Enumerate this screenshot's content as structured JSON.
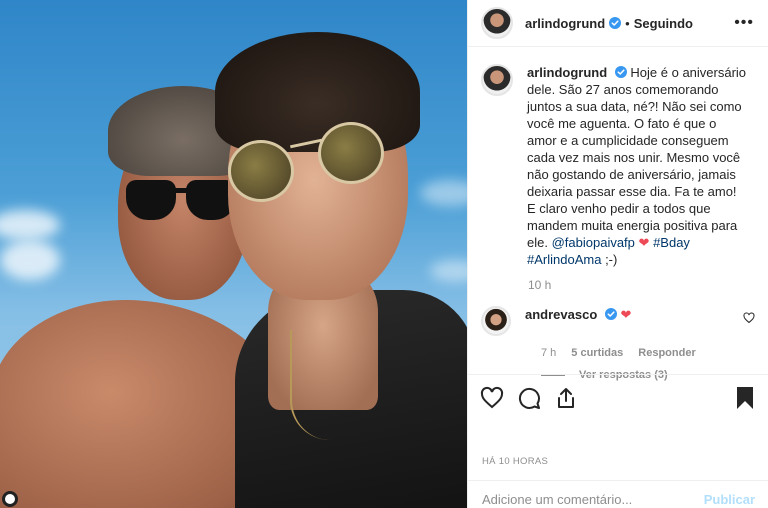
{
  "header": {
    "username": "arlindogrund",
    "separator": "•",
    "follow_status": "Seguindo",
    "more": "•••"
  },
  "caption": {
    "username": "arlindogrund",
    "text_before_mention": "Hoje é o aniversário dele. São 27 anos comemorando juntos a sua data, né?! Não sei como você me aguenta. O fato é que o amor e a cumplicidade conseguem cada vez mais nos unir. Mesmo você não gostando de aniversário, jamais deixaria passar esse dia. Fa te amo! E claro venho pedir a todos que mandem muita energia positiva para ele.",
    "mention": "@fabiopaivafp",
    "heart": "❤",
    "hashtag1": "#Bday",
    "hashtag2": "#ArlindoAma",
    "emoticon": ";-)",
    "time": "10 h"
  },
  "comment": {
    "username": "andrevasco",
    "heart": "❤",
    "time": "7 h",
    "likes": "5 curtidas",
    "reply": "Responder",
    "view_replies": "Ver respostas (3)"
  },
  "footer": {
    "ago": "HÁ 10 HORAS",
    "comment_placeholder": "Adicione um comentário...",
    "publish": "Publicar"
  },
  "colors": {
    "verified": "#3897f0",
    "heart": "#ed4956",
    "mention": "#00376b",
    "publish_disabled": "#b2dffc"
  },
  "icons": [
    "verified-badge-icon",
    "more-options-icon",
    "like-icon",
    "comment-icon",
    "share-icon",
    "bookmark-icon",
    "small-like-icon"
  ]
}
